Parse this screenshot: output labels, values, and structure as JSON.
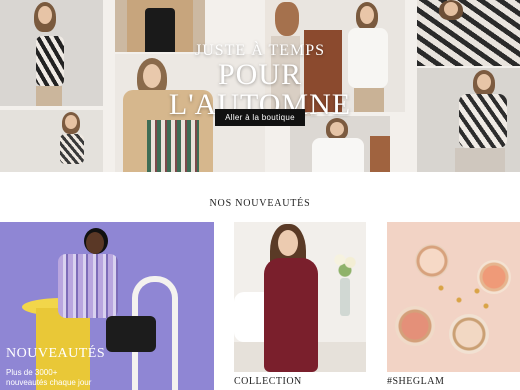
{
  "hero": {
    "subtitle": "JUSTE À TEMPS",
    "title": "POUR L'AUTOMNE",
    "button_label": "Aller à la boutique"
  },
  "section": {
    "title": "NOS NOUVEAUTÉS"
  },
  "cards": [
    {
      "title": "NOUVEAUTÉS",
      "desc_line1": "Plus de 3000+",
      "desc_line2": "nouveautés chaque jour"
    },
    {
      "caption": "COLLECTION"
    },
    {
      "caption": "#SHEGLAM"
    }
  ],
  "colors": {
    "hero_bg": "#f3f0ec",
    "button_bg": "#111111",
    "card1_bg": "#8f86d4",
    "card3_bg": "#f2d3c5"
  }
}
